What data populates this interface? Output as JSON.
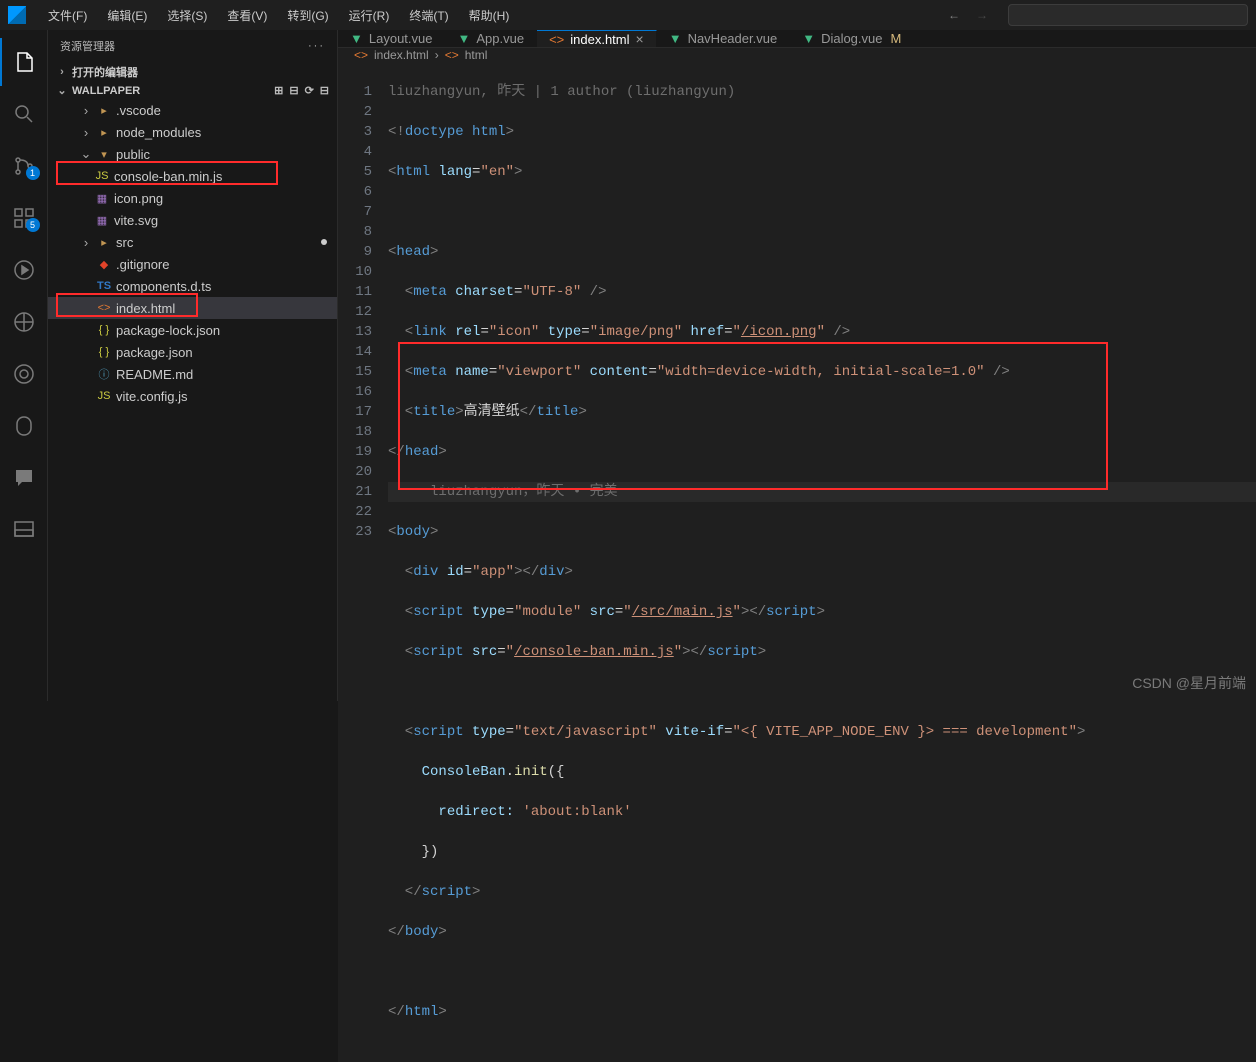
{
  "menu": [
    "文件(F)",
    "编辑(E)",
    "选择(S)",
    "查看(V)",
    "转到(G)",
    "运行(R)",
    "终端(T)",
    "帮助(H)"
  ],
  "activity": {
    "scm_badge": "1",
    "ext_badge": "5"
  },
  "sidebar": {
    "title": "资源管理器",
    "open_editors": "打开的编辑器",
    "project": "WALLPAPER",
    "files": {
      "vscode": ".vscode",
      "node_modules": "node_modules",
      "public": "public",
      "console_ban": "console-ban.min.js",
      "icon_png": "icon.png",
      "vite_svg": "vite.svg",
      "src": "src",
      "gitignore": ".gitignore",
      "components": "components.d.ts",
      "index_html": "index.html",
      "pkg_lock": "package-lock.json",
      "pkg": "package.json",
      "readme": "README.md",
      "vite_config": "vite.config.js"
    }
  },
  "tabs": [
    {
      "label": "Layout.vue",
      "type": "vue"
    },
    {
      "label": "App.vue",
      "type": "vue"
    },
    {
      "label": "index.html",
      "type": "html",
      "active": true,
      "close": true
    },
    {
      "label": "NavHeader.vue",
      "type": "vue"
    },
    {
      "label": "Dialog.vue",
      "type": "vue",
      "mod": "M"
    }
  ],
  "breadcrumb": {
    "file": "index.html",
    "sym": "html"
  },
  "blame": {
    "top": "liuzhangyun, 昨天 | 1 author (liuzhangyun)",
    "inline": "     liuzhangyun，昨天 • 完美"
  },
  "code": {
    "l1": {
      "a": "<!",
      "b": "doctype",
      "c": " html",
      "d": ">"
    },
    "l2": {
      "a": "<",
      "b": "html",
      "c": " lang",
      "d": "=",
      "e": "\"en\"",
      "f": ">"
    },
    "l4": {
      "a": "<",
      "b": "head",
      "c": ">"
    },
    "l5": {
      "a": "  <",
      "b": "meta",
      "c": " charset",
      "d": "=",
      "e": "\"UTF-8\"",
      "f": " />"
    },
    "l6": {
      "a": "  <",
      "b": "link",
      "c": " rel",
      "d": "=",
      "e": "\"icon\"",
      "f": " type",
      "g": "=",
      "h": "\"image/png\"",
      "i": " href",
      "j": "=",
      "k": "\"",
      "l": "/icon.png",
      "m": "\"",
      "n": " />"
    },
    "l7": {
      "a": "  <",
      "b": "meta",
      "c": " name",
      "d": "=",
      "e": "\"viewport\"",
      "f": " content",
      "g": "=",
      "h": "\"width=device-width, initial-scale=1.0\"",
      "i": " />"
    },
    "l8": {
      "a": "  <",
      "b": "title",
      "c": ">",
      "d": "高清壁纸",
      "e": "</",
      "f": "title",
      "g": ">"
    },
    "l9": {
      "a": "</",
      "b": "head",
      "c": ">"
    },
    "l11": {
      "a": "<",
      "b": "body",
      "c": ">"
    },
    "l12": {
      "a": "  <",
      "b": "div",
      "c": " id",
      "d": "=",
      "e": "\"app\"",
      "f": "></",
      "g": "div",
      "h": ">"
    },
    "l13": {
      "a": "  <",
      "b": "script",
      "c": " type",
      "d": "=",
      "e": "\"module\"",
      "f": " src",
      "g": "=",
      "h": "\"",
      "i": "/src/main.js",
      "j": "\"",
      "k": "></",
      "l": "script",
      "m": ">"
    },
    "l14": {
      "a": "  <",
      "b": "script",
      "c": " src",
      "d": "=",
      "e": "\"",
      "f": "/console-ban.min.js",
      "g": "\"",
      "h": "></",
      "i": "script",
      "j": ">"
    },
    "l16": {
      "a": "  <",
      "b": "script",
      "c": " type",
      "d": "=",
      "e": "\"text/javascript\"",
      "f": " vite-if",
      "g": "=",
      "h": "\"<{ VITE_APP_NODE_ENV }> === development\"",
      "i": ">"
    },
    "l17": {
      "a": "    ConsoleBan",
      "b": ".",
      "c": "init",
      "d": "({"
    },
    "l18": {
      "a": "      ",
      "b": "redirect:",
      "c": " ",
      "d": "'about:blank'"
    },
    "l19": {
      "a": "    })"
    },
    "l20": {
      "a": "  </",
      "b": "script",
      "c": ">"
    },
    "l21": {
      "a": "</",
      "b": "body",
      "c": ">"
    },
    "l23": {
      "a": "</",
      "b": "html",
      "c": ">"
    }
  },
  "watermark": "CSDN @星月前端",
  "icons": {
    "js": "JS",
    "ts": "TS",
    "json": "{ }",
    "html": "<>",
    "img": "▦",
    "info": "ⓘ",
    "git": "◆"
  }
}
